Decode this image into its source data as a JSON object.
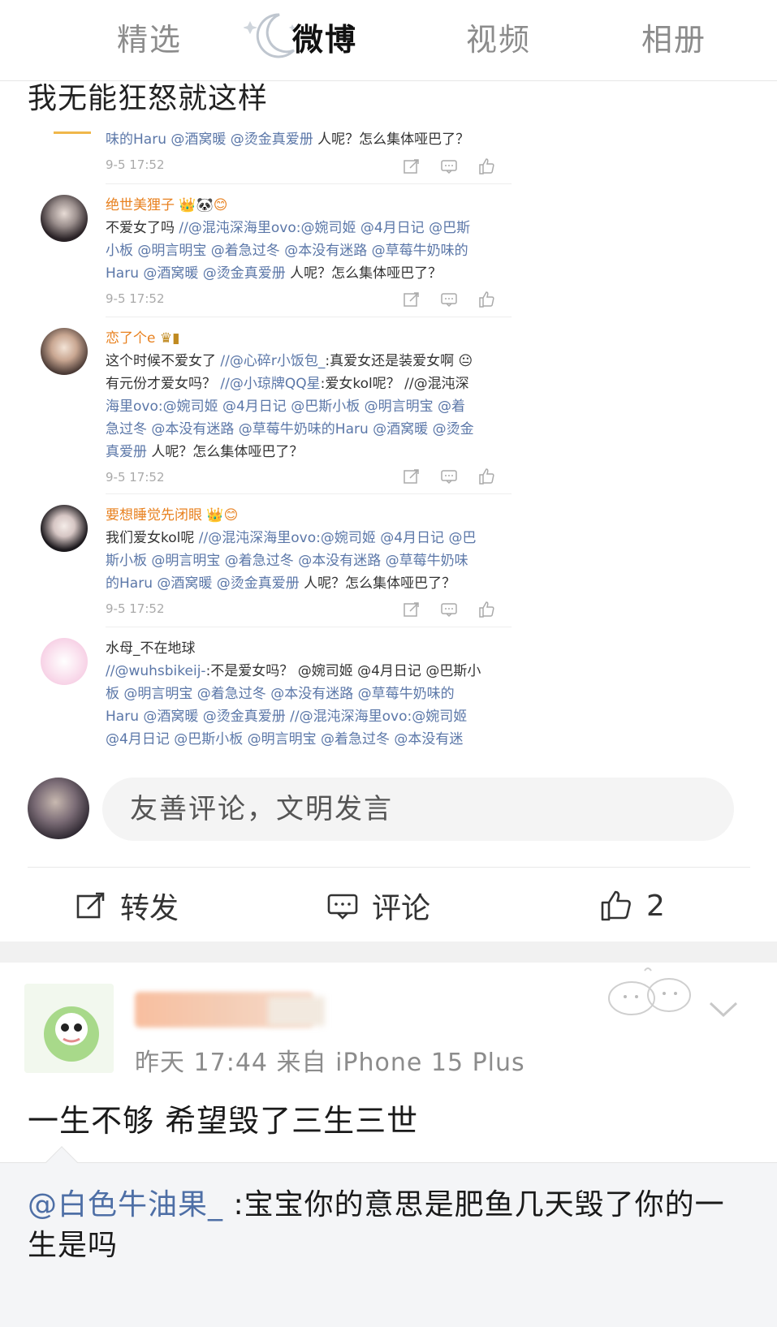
{
  "tabs": [
    {
      "label": "精选",
      "active": false
    },
    {
      "label": "微博",
      "active": true
    },
    {
      "label": "视频",
      "active": false
    },
    {
      "label": "相册",
      "active": false
    }
  ],
  "post": {
    "text": "我无能狂怒就这样"
  },
  "embedded_comments": {
    "first": {
      "text_link": "味的Haru @酒窝暖 @烫金真爱册",
      "text_tail": " 人呢？怎么集体哑巴了？",
      "time": "9-5 17:52"
    },
    "items": [
      {
        "name": "绝世美狸子",
        "lines": [
          {
            "plain": "不爱女了吗 ",
            "link": "//@混沌深海里ovo:@婉司姬 @4月日记 @巴斯"
          },
          {
            "plain": "",
            "link": "小板 @明言明宝 @着急过冬 @本没有迷路 @草莓牛奶味的"
          },
          {
            "plain": "",
            "link": "Haru @酒窝暖 @烫金真爱册",
            "tail": " 人呢？怎么集体哑巴了？"
          }
        ],
        "time": "9-5 17:52"
      },
      {
        "name": "恋了个e",
        "lines": [
          {
            "plain": "这个时候不爱女了 ",
            "link": "//@心碎r小饭包_",
            "tail": ":真爱女还是装爱女啊"
          },
          {
            "plain": "有元份才爱女吗？ ",
            "link": "//@小琼牌QQ星",
            "tail": ":爱女kol呢？ //@混沌深"
          },
          {
            "plain": "",
            "link": "海里ovo:@婉司姬 @4月日记 @巴斯小板 @明言明宝 @着"
          },
          {
            "plain": "",
            "link": "急过冬 @本没有迷路 @草莓牛奶味的Haru @酒窝暖 @烫金"
          },
          {
            "plain": "",
            "link": "真爱册",
            "tail": " 人呢？怎么集体哑巴了？"
          }
        ],
        "time": "9-5 17:52"
      },
      {
        "name": "要想睡觉先闭眼",
        "lines": [
          {
            "plain": "我们爱女kol呢 ",
            "link": "//@混沌深海里ovo:@婉司姬 @4月日记 @巴"
          },
          {
            "plain": "",
            "link": "斯小板 @明言明宝 @着急过冬 @本没有迷路 @草莓牛奶味"
          },
          {
            "plain": "",
            "link": "的Haru @酒窝暖 @烫金真爱册",
            "tail": " 人呢？怎么集体哑巴了？"
          }
        ],
        "time": "9-5 17:52"
      },
      {
        "name": "水母_不在地球",
        "lines": [
          {
            "plain": "",
            "link": "//@wuhsbikeij-",
            "tail": ":不是爱女吗？ @婉司姬 @4月日记 @巴斯小"
          },
          {
            "plain": "",
            "link": "板 @明言明宝 @着急过冬 @本没有迷路 @草莓牛奶味的"
          },
          {
            "plain": "",
            "link": "Haru @酒窝暖 @烫金真爱册 //@混沌深海里ovo:@婉司姬"
          },
          {
            "plain": "",
            "link": "@4月日记 @巴斯小板 @明言明宝 @着急过冬 @本没有迷"
          }
        ],
        "time": ""
      }
    ]
  },
  "comment_input": {
    "placeholder": "友善评论，文明发言"
  },
  "actions": {
    "repost_label": "转发",
    "comment_label": "评论",
    "like_count": "2"
  },
  "next_post": {
    "meta": "昨天 17:44  来自 iPhone 15 Plus",
    "text": "一生不够 希望毁了三生三世",
    "quote": {
      "mention": "@白色牛油果_",
      "text": " :宝宝你的意思是肥鱼几天毁了你的一生是吗"
    }
  },
  "colors": {
    "link": "#5b77a8",
    "name_orange": "#e8811f",
    "mention_blue": "#4e6fa6"
  }
}
